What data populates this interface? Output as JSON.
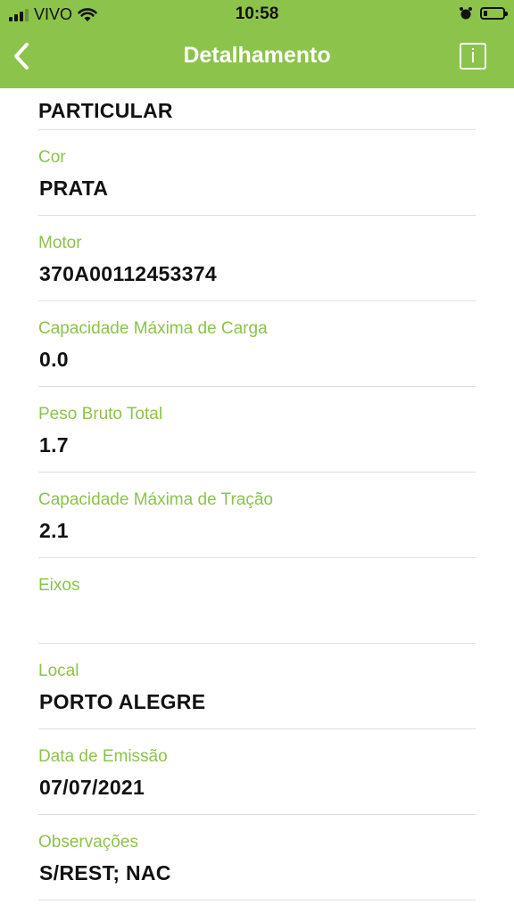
{
  "status_bar": {
    "carrier": "VIVO",
    "time": "10:58"
  },
  "header": {
    "title": "Detalhamento",
    "back_icon": "chevron-left-icon",
    "info_label": "i"
  },
  "partial_field": {
    "value": "PARTICULAR"
  },
  "fields": [
    {
      "label": "Cor",
      "value": "PRATA"
    },
    {
      "label": "Motor",
      "value": "370A00112453374"
    },
    {
      "label": "Capacidade Máxima de Carga",
      "value": "0.0"
    },
    {
      "label": "Peso Bruto Total",
      "value": "1.7"
    },
    {
      "label": "Capacidade Máxima de Tração",
      "value": "2.1"
    },
    {
      "label": "Eixos",
      "value": ""
    },
    {
      "label": "Local",
      "value": "PORTO ALEGRE"
    },
    {
      "label": "Data de Emissão",
      "value": "07/07/2021"
    },
    {
      "label": "Observações",
      "value": "S/REST; NAC"
    }
  ],
  "colors": {
    "accent": "#8cc34a",
    "divider": "#dedede"
  }
}
